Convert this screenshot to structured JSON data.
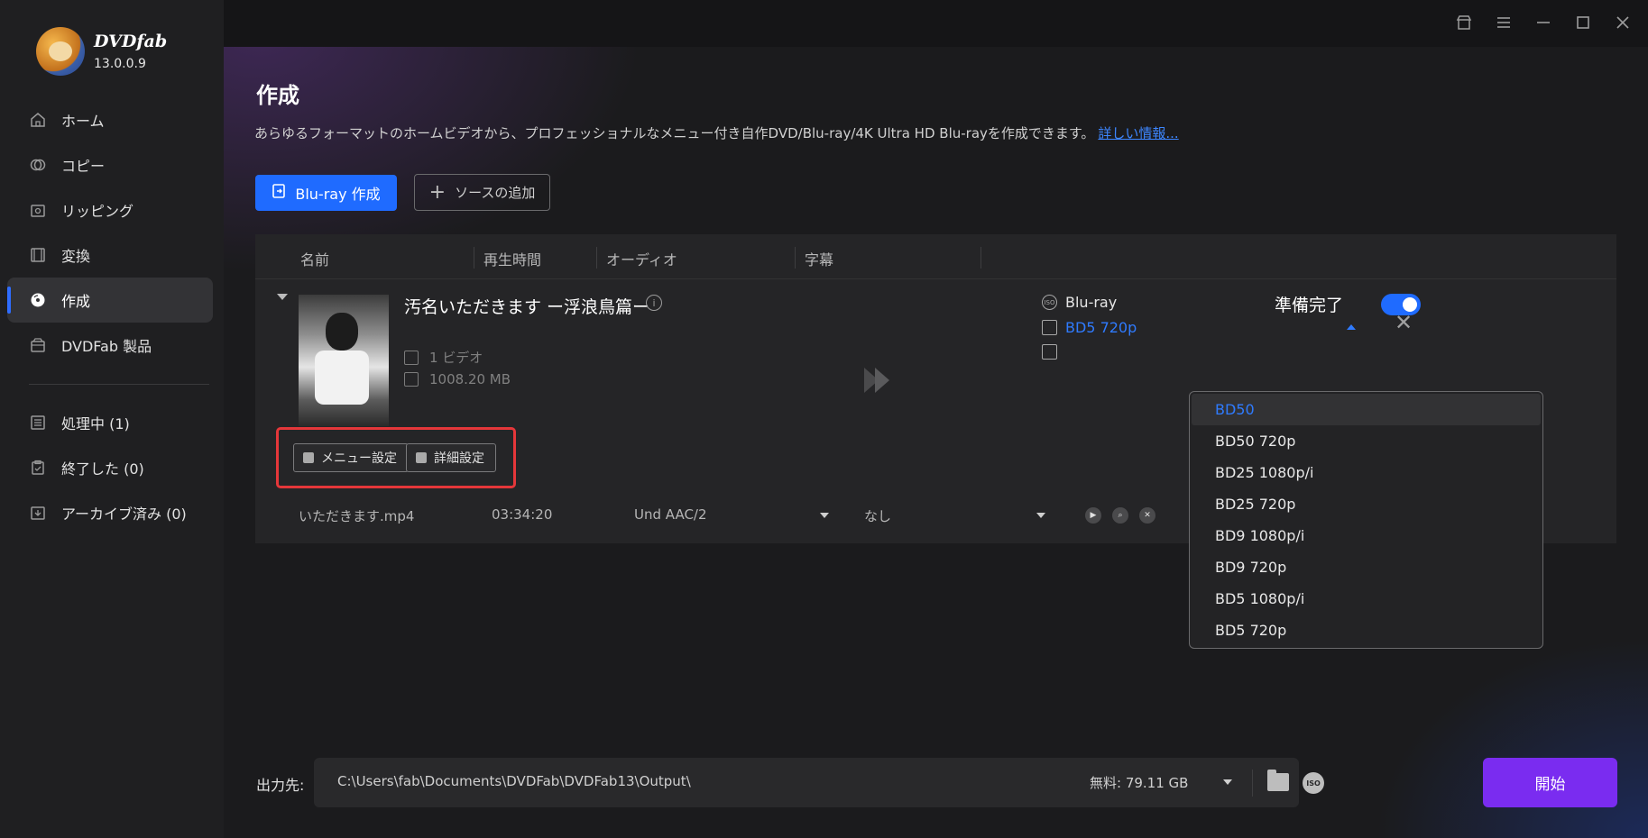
{
  "app": {
    "brand": "DVDfab",
    "version": "13.0.0.9"
  },
  "sidebar": {
    "items": [
      {
        "label": "ホーム",
        "icon": "home-icon"
      },
      {
        "label": "コピー",
        "icon": "copy-icon"
      },
      {
        "label": "リッピング",
        "icon": "ripper-icon"
      },
      {
        "label": "変換",
        "icon": "film-icon"
      },
      {
        "label": "作成",
        "icon": "disc-icon",
        "active": true
      },
      {
        "label": "DVDFab 製品",
        "icon": "box-icon"
      }
    ],
    "queue": [
      {
        "label": "処理中 (1)",
        "icon": "list-icon"
      },
      {
        "label": "終了した (0)",
        "icon": "clipboard-check-icon"
      },
      {
        "label": "アーカイブ済み (0)",
        "icon": "archive-icon"
      }
    ]
  },
  "page": {
    "title": "作成",
    "description": "あらゆるフォーマットのホームビデオから、プロフェッショナルなメニュー付き自作DVD/Blu-ray/4K Ultra HD Blu-rayを作成できます。",
    "more_link": "詳しい情報...",
    "primary_button": "Blu-ray 作成",
    "add_source_button": "ソースの追加"
  },
  "table": {
    "headers": [
      "名前",
      "再生時間",
      "オーディオ",
      "字幕"
    ]
  },
  "item": {
    "title": "汚名いただきます ー浮浪鳥篇ー",
    "video_count": "1 ビデオ",
    "size": "1008.20 MB",
    "menu_button": "メニュー設定",
    "advanced_button": "詳細設定",
    "status": "準備完了",
    "output_type": "Blu-ray",
    "output_profile": "BD5 720p",
    "file": {
      "name": "いただきます.mp4",
      "duration": "03:34:20",
      "audio": "Und  AAC/2",
      "subtitle": "なし"
    }
  },
  "dropdown": {
    "options": [
      "BD50",
      "BD50 720p",
      "BD25 1080p/i",
      "BD25 720p",
      "BD9 1080p/i",
      "BD9 720p",
      "BD5 1080p/i",
      "BD5 720p"
    ],
    "highlighted": "BD50"
  },
  "bottom": {
    "output_label": "出力先:",
    "path": "C:\\Users\\fab\\Documents\\DVDFab\\DVDFab13\\Output\\",
    "free_space": "無料: 79.11 GB",
    "start_button": "開始"
  },
  "colors": {
    "accent": "#1f6bff",
    "start": "#7a2cf0",
    "highlight_box": "#e5373a"
  }
}
